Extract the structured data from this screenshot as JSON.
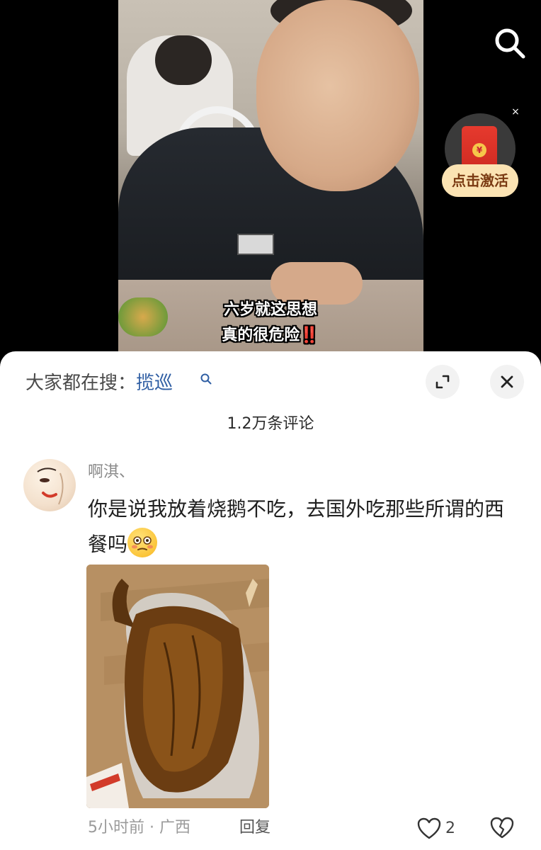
{
  "video": {
    "subtitle_line1": "六岁就这思想",
    "subtitle_line2": "真的很危险",
    "subtitle_emphasis": "‼️",
    "search_icon": "search-icon",
    "redpack": {
      "icon": "red-envelope-icon",
      "coin_symbol": "¥",
      "cta_label": "点击激活",
      "dismiss_symbol": "×"
    }
  },
  "comments_panel": {
    "search_hint_label": "大家都在搜：",
    "search_hint_term": "揽巡",
    "expand_icon": "expand-icon",
    "close_icon": "close-icon",
    "count_label": "1.2万条评论",
    "comment": {
      "username": "啊淇、",
      "text": "你是说我放着烧鹅不吃，去国外吃那些所谓的西餐吗",
      "emoji": "flushed-face-emoji",
      "photo": "roast-goose-photo",
      "time": "5小时前",
      "separator": "·",
      "location": "广西",
      "reply_label": "回复",
      "like_count": "2",
      "like_icon": "heart-icon",
      "dislike_icon": "broken-heart-icon"
    }
  },
  "colors": {
    "accent_link": "#2f5ea3",
    "redpack_cta_bg": "#fbe3b3",
    "subtitle_emphasis": "#ff2b2b"
  }
}
